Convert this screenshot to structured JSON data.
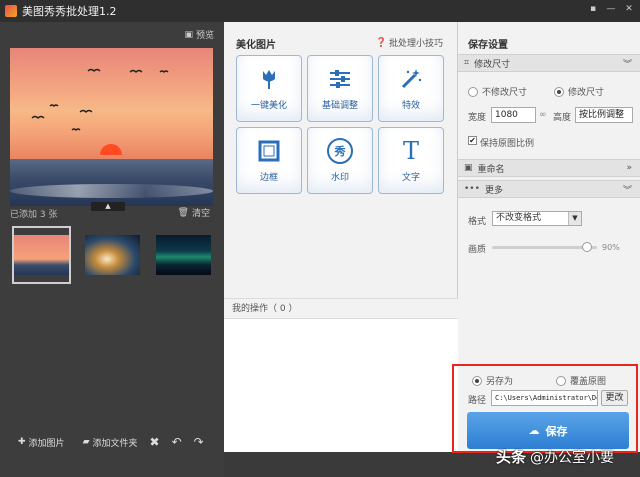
{
  "window": {
    "title": "美图秀秀批处理1.2"
  },
  "left": {
    "preview_label": "预览",
    "added_count": "已添加 3 张",
    "clear_label": "清空",
    "add_image_label": "添加图片",
    "add_folder_label": "添加文件夹"
  },
  "middle": {
    "heading": "美化图片",
    "tips_label": "批处理小技巧",
    "tools": [
      {
        "label": "一键美化",
        "icon": "tulip-icon"
      },
      {
        "label": "基础调整",
        "icon": "sliders-icon"
      },
      {
        "label": "特效",
        "icon": "magic-wand-icon"
      },
      {
        "label": "边框",
        "icon": "frame-icon"
      },
      {
        "label": "水印",
        "icon": "xiu-seal-icon",
        "glyph": "秀"
      },
      {
        "label": "文字",
        "icon": "text-t-icon",
        "glyph": "T"
      }
    ],
    "ops_heading": "我的操作（ 0 ）"
  },
  "right": {
    "title": "保存设置",
    "resize_section": "修改尺寸",
    "no_resize": "不修改尺寸",
    "resize": "修改尺寸",
    "width_label": "宽度",
    "width_value": "1080",
    "height_label": "高度",
    "height_value": "按比例调整",
    "keep_ratio": "保持原图比例",
    "rename_section": "重命名",
    "more_section": "更多",
    "format_label": "格式",
    "format_value": "不改变格式",
    "quality_label": "画质",
    "quality_value": "90%",
    "quality_fraction": 0.9,
    "save_as": "另存为",
    "overwrite": "覆盖原图",
    "path_label": "路径",
    "path_value": "C:\\Users\\Administrator\\De:",
    "change_label": "更改",
    "save_label": "保存"
  },
  "watermark": {
    "head": "头条",
    "text": "@办公室小要"
  },
  "colors": {
    "accent": "#2d7fd3",
    "highlight": "#e8251f",
    "dark_bg": "#3d3d3d"
  }
}
